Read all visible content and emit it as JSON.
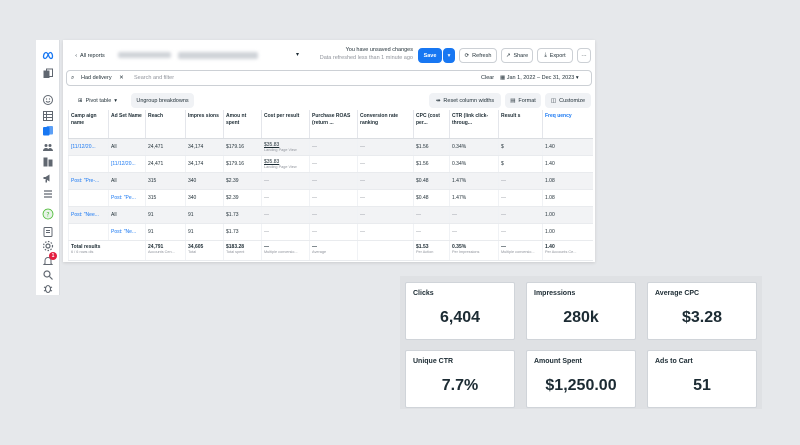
{
  "header": {
    "back_label": "All reports",
    "unsaved_title": "You have unsaved changes",
    "unsaved_sub": "Data refreshed less than 1 minute ago",
    "save_label": "Save",
    "refresh_label": "Refresh",
    "share_label": "Share",
    "export_label": "Export",
    "more_label": "···"
  },
  "filter": {
    "chip_label": "Had delivery",
    "search_placeholder": "Search and filter",
    "clear_label": "Clear",
    "date_range": "Jan 1, 2022 – Dec 31, 2023"
  },
  "toolbar": {
    "pivot_label": "Pivot table",
    "ungroup_label": "Ungroup breakdowns",
    "reset_label": "Reset column widths",
    "format_label": "Format",
    "customize_label": "Customize"
  },
  "table": {
    "headers": [
      "Camp aign name",
      "Ad Set Name",
      "Reach",
      "Impres sions",
      "Amou nt spent",
      "Cost per result",
      "Purchase ROAS (return ...",
      "Conversion rate ranking",
      "CPC (cost per...",
      "CTR (link click-throug...",
      "Result s",
      "Freq uency"
    ],
    "rows": [
      [
        "[11/12/20...",
        "All",
        "24,471",
        "34,174",
        "$179.16",
        "$35.83",
        "—",
        "—",
        "$1.56",
        "0.34%",
        "$",
        "1.40"
      ],
      [
        "",
        "[11/12/20...",
        "24,471",
        "34,174",
        "$179.16",
        "$35.83",
        "—",
        "—",
        "$1.56",
        "0.34%",
        "$",
        "1.40"
      ],
      [
        "Post: \"Pre-...",
        "All",
        "315",
        "340",
        "$2.39",
        "—",
        "—",
        "—",
        "$0.48",
        "1.47%",
        "—",
        "1.08"
      ],
      [
        "",
        "Post: \"Pe...",
        "315",
        "340",
        "$2.39",
        "—",
        "—",
        "—",
        "$0.48",
        "1.47%",
        "—",
        "1.08"
      ],
      [
        "Post: \"Nee...",
        "All",
        "91",
        "91",
        "$1.73",
        "—",
        "—",
        "—",
        "—",
        "—",
        "—",
        "1.00"
      ],
      [
        "",
        "Post: \"Ne...",
        "91",
        "91",
        "$1.73",
        "—",
        "—",
        "—",
        "—",
        "—",
        "—",
        "1.00"
      ]
    ],
    "cost_sub": "Landing Page View",
    "total": {
      "label": "Total results",
      "label_sub": "6 / 6 rows dis",
      "reach": "24,791",
      "reach_sub": "Accounts Cen...",
      "impressions": "34,605",
      "impressions_sub": "Total",
      "spent": "$183.28",
      "spent_sub": "Total spent",
      "cost": "—",
      "cost_sub": "Multiple conversio...",
      "roas": "—",
      "roas_sub": "Average",
      "cpc": "$1.53",
      "cpc_sub": "Per Action",
      "ctr": "0.35%",
      "ctr_sub": "Per Impressions",
      "results": "—",
      "results_sub": "Multiple conversio...",
      "freq": "1.40",
      "freq_sub": "Per Accounts Ce..."
    }
  },
  "cards": [
    {
      "label": "Clicks",
      "value": "6,404"
    },
    {
      "label": "Impressions",
      "value": "280k"
    },
    {
      "label": "Average CPC",
      "value": "$3.28"
    },
    {
      "label": "Unique CTR",
      "value": "7.7%"
    },
    {
      "label": "Amount Spent",
      "value": "$1,250.00"
    },
    {
      "label": "Ads to Cart",
      "value": "51"
    }
  ],
  "notifications_count": "1",
  "help_glyph": "?",
  "colors": {
    "accent": "#1877f2",
    "text": "#1c2b33",
    "badge": "#e41e3f"
  },
  "icons": [
    "meta-logo-icon",
    "pages-icon",
    "smiley-icon",
    "grid-icon",
    "reports-icon",
    "audience-icon",
    "library-icon",
    "megaphone-icon",
    "menu-icon",
    "help-icon",
    "document-icon",
    "settings-icon",
    "notification-icon",
    "search-icon",
    "bug-icon"
  ]
}
